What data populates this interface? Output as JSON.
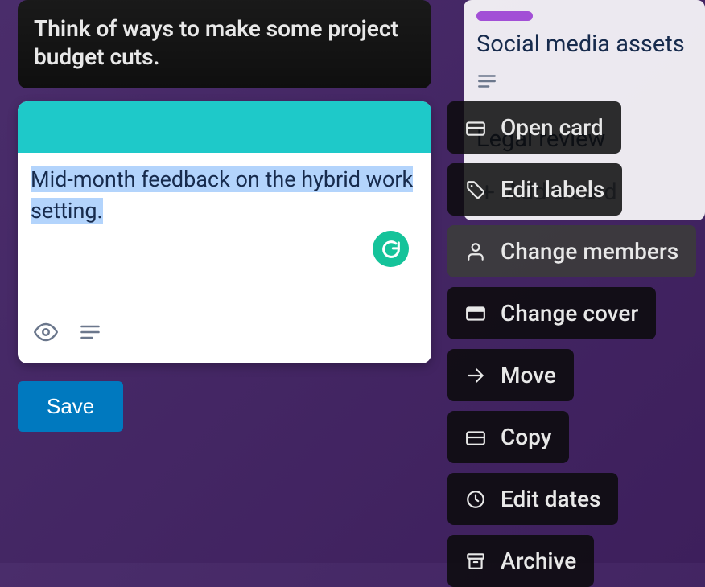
{
  "top_card": {
    "title": "Think of ways to make some project budget cuts."
  },
  "edit_card": {
    "text": "Mid-month feedback on the hybrid work setting.",
    "cover_color": "#1ec9c9"
  },
  "save_button_label": "Save",
  "background_list": {
    "label_color": "#a24fd6",
    "card1_title": "Social media assets",
    "card2_title": "Legal review",
    "add_card_label": "Add a card"
  },
  "context_menu": {
    "items": [
      {
        "icon": "card-icon",
        "label": "Open card"
      },
      {
        "icon": "tag-icon",
        "label": "Edit labels"
      },
      {
        "icon": "user-icon",
        "label": "Change members",
        "hover": true
      },
      {
        "icon": "cover-icon",
        "label": "Change cover"
      },
      {
        "icon": "arrow-right-icon",
        "label": "Move"
      },
      {
        "icon": "card-icon",
        "label": "Copy"
      },
      {
        "icon": "clock-icon",
        "label": "Edit dates"
      },
      {
        "icon": "archive-icon",
        "label": "Archive"
      }
    ]
  }
}
